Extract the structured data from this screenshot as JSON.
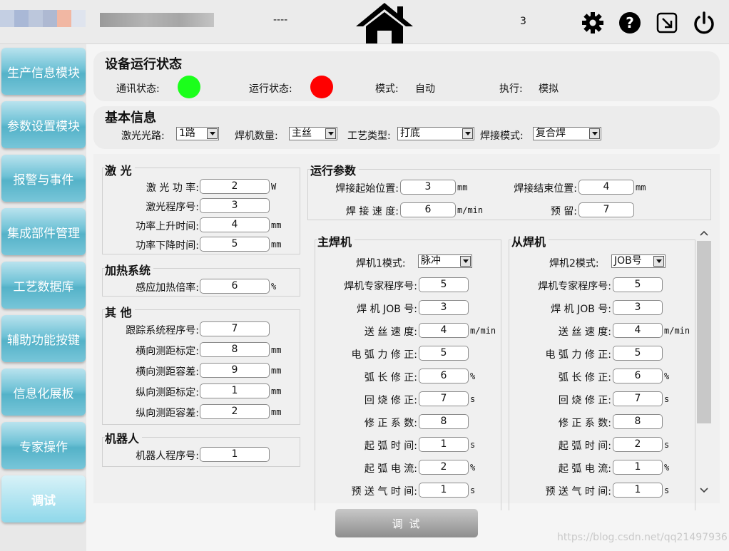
{
  "header": {
    "dash": "----",
    "count": "3"
  },
  "colors": {
    "ok": "#1bff1b",
    "err": "#ff0000",
    "nav": "#5ab6cb"
  },
  "nav": [
    "生产信息模块",
    "参数设置模块",
    "报警与事件",
    "集成部件管理",
    "工艺数据库",
    "辅助功能按键",
    "信息化展板",
    "专家操作",
    "调试"
  ],
  "status": {
    "title": "设备运行状态",
    "comm_label": "通讯状态:",
    "run_label": "运行状态:",
    "mode_label": "模式:",
    "mode": "自动",
    "exec_label": "执行:",
    "exec": "模拟"
  },
  "basic": {
    "title": "基本信息",
    "laser_path_label": "激光光路:",
    "laser_path": "1路",
    "welder_count_label": "焊机数量:",
    "welder_count": "主丝",
    "process_label": "工艺类型:",
    "process": "打底",
    "weld_mode_label": "焊接模式:",
    "weld_mode": "复合焊"
  },
  "laser": {
    "title": "激 光",
    "rows": [
      {
        "label": "激 光 功 率:",
        "value": "2",
        "unit": "W"
      },
      {
        "label": "激光程序号:",
        "value": "3",
        "unit": ""
      },
      {
        "label": "功率上升时间:",
        "value": "4",
        "unit": "mm"
      },
      {
        "label": "功率下降时间:",
        "value": "5",
        "unit": "mm"
      }
    ]
  },
  "heat": {
    "title": "加热系统",
    "rows": [
      {
        "label": "感应加热倍率:",
        "value": "6",
        "unit": "%"
      }
    ]
  },
  "other": {
    "title": "其 他",
    "rows": [
      {
        "label": "跟踪系统程序号:",
        "value": "7",
        "unit": ""
      },
      {
        "label": "横向测距标定:",
        "value": "8",
        "unit": "mm"
      },
      {
        "label": "横向测距容差:",
        "value": "9",
        "unit": "mm"
      },
      {
        "label": "纵向测距标定:",
        "value": "1",
        "unit": "mm"
      },
      {
        "label": "纵向测距容差:",
        "value": "2",
        "unit": "mm"
      }
    ]
  },
  "robot": {
    "title": "机器人",
    "rows": [
      {
        "label": "机器人程序号:",
        "value": "1",
        "unit": ""
      }
    ]
  },
  "run": {
    "title": "运行参数",
    "rows": [
      {
        "label": "焊接起始位置:",
        "value": "3",
        "unit": "mm"
      },
      {
        "label": "焊接结束位置:",
        "value": "4",
        "unit": "mm"
      },
      {
        "label": "焊 接 速 度:",
        "value": "6",
        "unit": "m/min"
      },
      {
        "label": "预 留:",
        "value": "7",
        "unit": ""
      }
    ]
  },
  "master": {
    "title": "主焊机",
    "mode_label": "焊机1模式:",
    "mode": "脉冲",
    "rows": [
      {
        "label": "焊机专家程序号:",
        "value": "5",
        "unit": ""
      },
      {
        "label": "焊 机 JOB 号:",
        "value": "3",
        "unit": ""
      },
      {
        "label": "送 丝 速 度:",
        "value": "4",
        "unit": "m/min"
      },
      {
        "label": "电 弧 力 修 正:",
        "value": "5",
        "unit": ""
      },
      {
        "label": "弧 长 修 正:",
        "value": "6",
        "unit": "%"
      },
      {
        "label": "回 烧 修 正:",
        "value": "7",
        "unit": "s"
      },
      {
        "label": "修 正 系 数:",
        "value": "8",
        "unit": ""
      },
      {
        "label": "起 弧 时 间:",
        "value": "1",
        "unit": "s"
      },
      {
        "label": "起 弧 电 流:",
        "value": "2",
        "unit": "%"
      },
      {
        "label": "预 送 气 时 间:",
        "value": "1",
        "unit": "s"
      }
    ]
  },
  "slave": {
    "title": "从焊机",
    "mode_label": "焊机2模式:",
    "mode": "JOB号",
    "rows": [
      {
        "label": "焊机专家程序号:",
        "value": "5",
        "unit": ""
      },
      {
        "label": "焊 机 JOB 号:",
        "value": "3",
        "unit": ""
      },
      {
        "label": "送 丝 速 度:",
        "value": "4",
        "unit": "m/min"
      },
      {
        "label": "电 弧 力 修 正:",
        "value": "5",
        "unit": ""
      },
      {
        "label": "弧 长 修 正:",
        "value": "6",
        "unit": "%"
      },
      {
        "label": "回 烧 修 正:",
        "value": "7",
        "unit": "s"
      },
      {
        "label": "修 正 系 数:",
        "value": "8",
        "unit": ""
      },
      {
        "label": "起 弧 时 间:",
        "value": "2",
        "unit": "s"
      },
      {
        "label": "起 弧 电 流:",
        "value": "1",
        "unit": "%"
      },
      {
        "label": "预 送 气 时 间:",
        "value": "1",
        "unit": "s"
      }
    ]
  },
  "debug_button": "调 试",
  "watermark": "https://blog.csdn.net/qq21497936"
}
